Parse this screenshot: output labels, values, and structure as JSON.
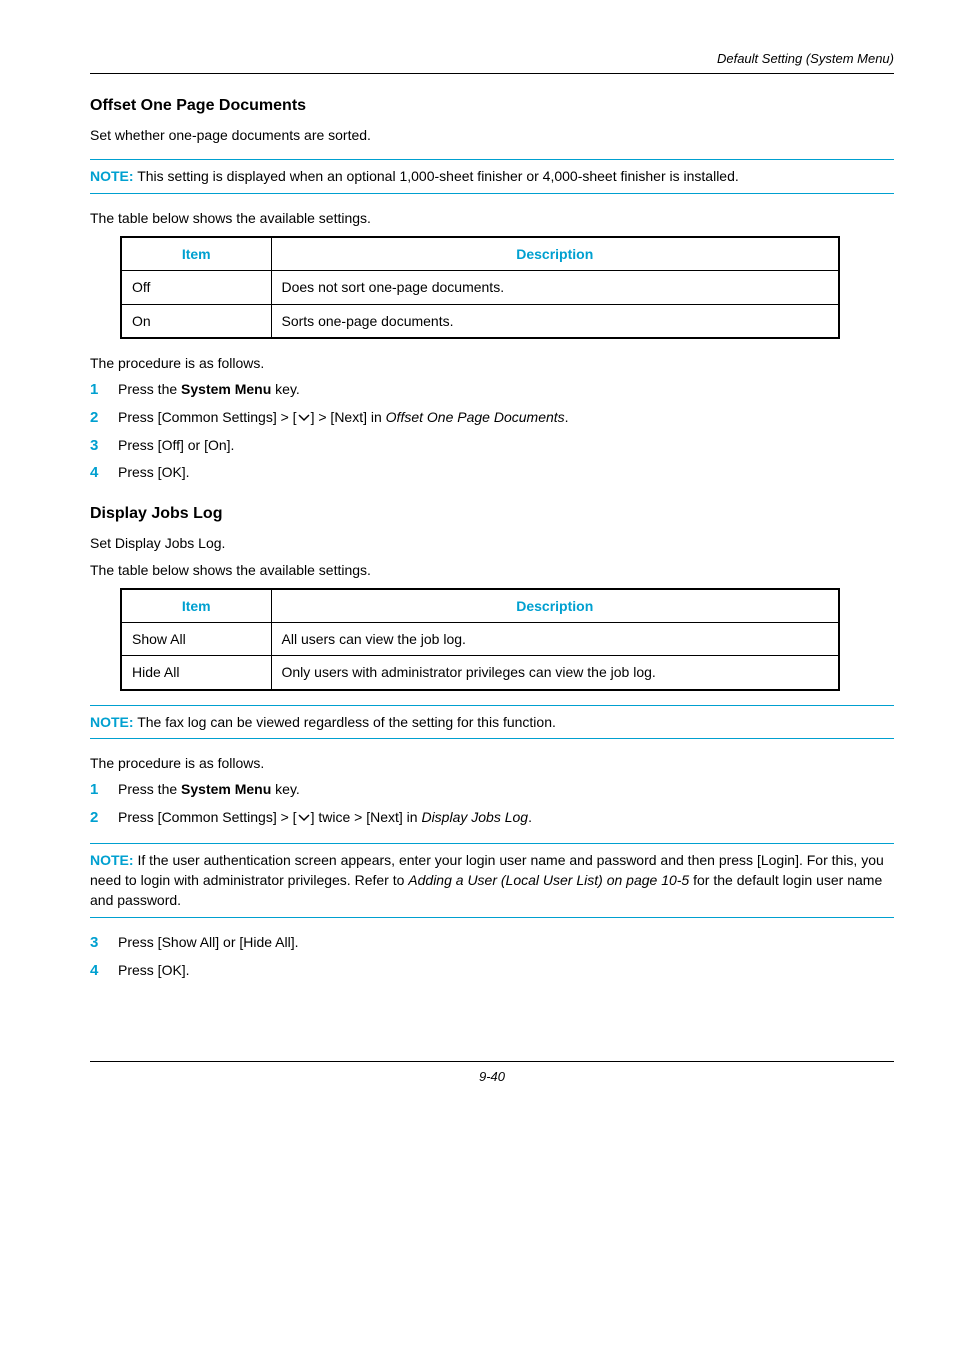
{
  "running_head": "Default Setting (System Menu)",
  "section1": {
    "heading": "Offset One Page Documents",
    "intro": "Set whether one-page documents are sorted.",
    "note": "This setting is displayed when an optional 1,000-sheet finisher or 4,000-sheet finisher is installed.",
    "table_lead": "The table below shows the available settings.",
    "th_item": "Item",
    "th_desc": "Description",
    "rows": [
      {
        "item": "Off",
        "desc": "Does not sort one-page documents."
      },
      {
        "item": "On",
        "desc": "Sorts one-page documents."
      }
    ],
    "proc_lead": "The procedure is as follows.",
    "steps": [
      {
        "n": "1",
        "pre": "Press the ",
        "bold": "System Menu",
        "post": " key."
      },
      {
        "n": "2",
        "pre": "Press [Common Settings] > [",
        "post": "] > [Next] in ",
        "ital": "Offset One Page Documents",
        "tail": "."
      },
      {
        "n": "3",
        "text": "Press [Off] or [On]."
      },
      {
        "n": "4",
        "text": "Press [OK]."
      }
    ]
  },
  "section2": {
    "heading": "Display Jobs Log",
    "intro1": "Set Display Jobs Log.",
    "intro2": "The table below shows the available settings.",
    "th_item": "Item",
    "th_desc": "Description",
    "rows": [
      {
        "item": "Show All",
        "desc": "All users can view the job log."
      },
      {
        "item": "Hide All",
        "desc": "Only users with administrator privileges can view the job log."
      }
    ],
    "note1": "The fax log can be viewed regardless of the setting for this function.",
    "proc_lead": "The procedure is as follows.",
    "steps1": [
      {
        "n": "1",
        "pre": "Press the ",
        "bold": "System Menu",
        "post": " key."
      },
      {
        "n": "2",
        "pre": "Press [Common Settings] > [",
        "post": "] twice > [Next] in ",
        "ital": "Display Jobs Log",
        "tail": "."
      }
    ],
    "note2_a": "If the user authentication screen appears, enter your login user name and password and then press [Login]. For this, you need to login with administrator privileges. Refer to ",
    "note2_ital": "Adding a User (Local User List) on page 10-5",
    "note2_b": " for the default login user name and password.",
    "steps2": [
      {
        "n": "3",
        "text": "Press [Show All] or [Hide All]."
      },
      {
        "n": "4",
        "text": "Press [OK]."
      }
    ]
  },
  "note_label": "NOTE:",
  "page_number": "9-40"
}
